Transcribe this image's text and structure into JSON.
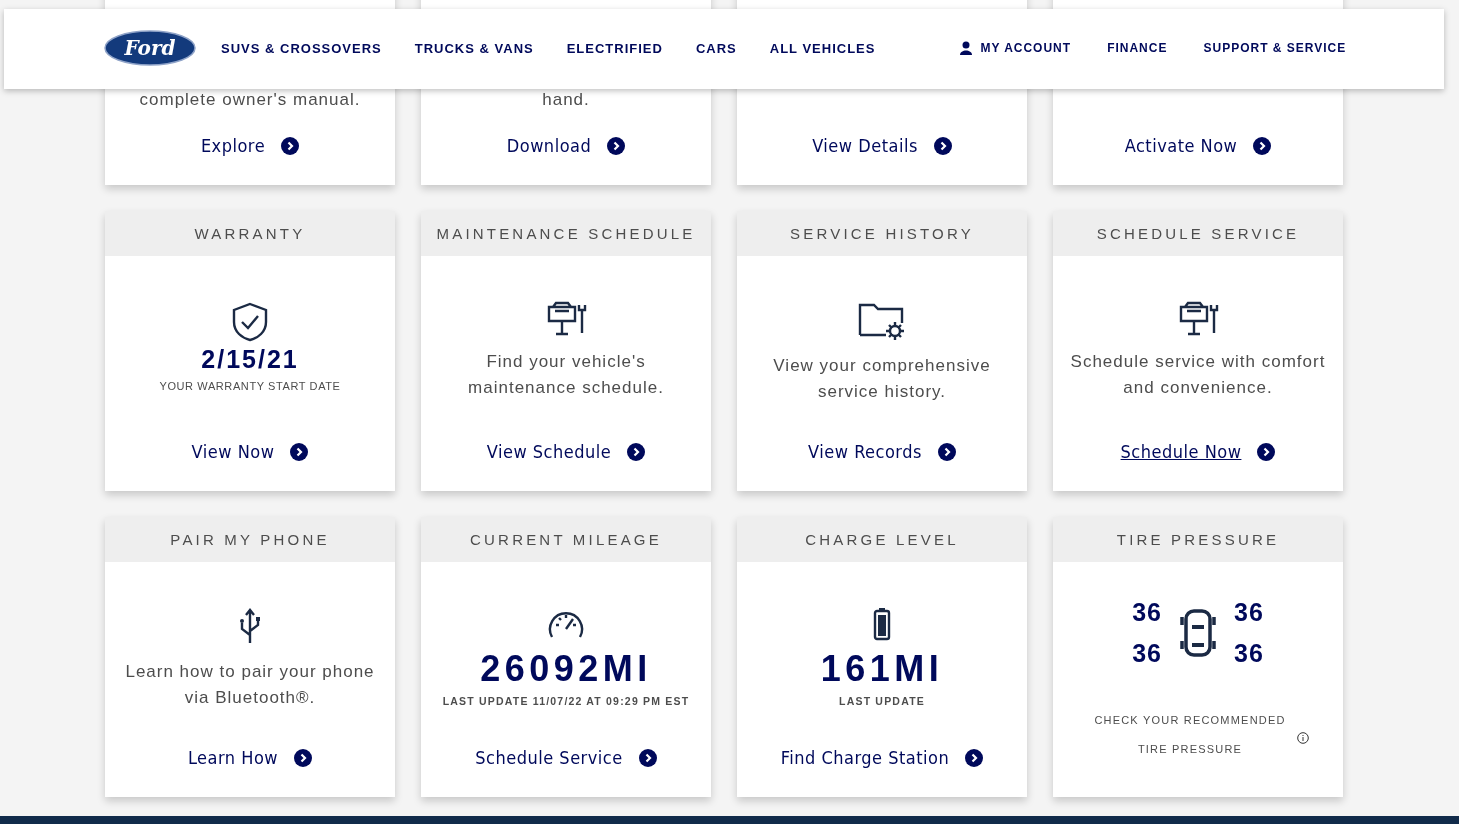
{
  "header": {
    "logo": "Ford",
    "nav": [
      {
        "label": "SUVS & CROSSOVERS"
      },
      {
        "label": "TRUCKS & VANS"
      },
      {
        "label": "ELECTRIFIED"
      },
      {
        "label": "CARS"
      },
      {
        "label": "ALL VEHICLES"
      }
    ],
    "account_nav": [
      {
        "label": "MY ACCOUNT",
        "kind": "account"
      },
      {
        "label": "FINANCE",
        "kind": "plain"
      },
      {
        "label": "SUPPORT & SERVICE",
        "kind": "plain"
      }
    ]
  },
  "cards": [
    {
      "kind": "partial",
      "text": "complete owner's manual.",
      "link": {
        "label": "Explore",
        "focused": false
      }
    },
    {
      "kind": "partial",
      "text": "hand.",
      "link": {
        "label": "Download",
        "focused": false
      }
    },
    {
      "kind": "partial",
      "link": {
        "label": "View Details",
        "focused": false
      }
    },
    {
      "kind": "partial",
      "link": {
        "label": "Activate Now",
        "focused": false
      }
    },
    {
      "kind": "value",
      "title": "WARRANTY",
      "value": "2/15/21",
      "caption": "YOUR WARRANTY START DATE",
      "link": {
        "label": "View Now",
        "focused": false
      }
    },
    {
      "kind": "text",
      "title": "MAINTENANCE SCHEDULE",
      "text": "Find your vehicle's maintenance schedule.",
      "link": {
        "label": "View Schedule",
        "focused": false
      }
    },
    {
      "kind": "text",
      "title": "SERVICE HISTORY",
      "text": "View your comprehensive service history.",
      "link": {
        "label": "View Records",
        "focused": false
      }
    },
    {
      "kind": "text",
      "title": "SCHEDULE SERVICE",
      "text": "Schedule service with comfort and convenience.",
      "link": {
        "label": "Schedule Now",
        "focused": true
      }
    },
    {
      "kind": "text",
      "title": "PAIR MY PHONE",
      "text": "Learn how to pair your phone via Bluetooth®.",
      "link": {
        "label": "Learn How",
        "focused": false
      }
    },
    {
      "kind": "bigvalue",
      "title": "CURRENT MILEAGE",
      "value": "26092MI",
      "caption": "LAST UPDATE 11/07/22 AT 09:29 PM EST",
      "link": {
        "label": "Schedule Service",
        "focused": false
      }
    },
    {
      "kind": "bigvalue",
      "title": "CHARGE LEVEL",
      "value": "161MI",
      "caption": "LAST UPDATE",
      "link": {
        "label": "Find Charge Station",
        "focused": false
      }
    },
    {
      "kind": "tire",
      "title": "TIRE PRESSURE",
      "tires": [
        "36",
        "36",
        "36",
        "36"
      ],
      "caption": "CHECK YOUR RECOMMENDED TIRE PRESSURE"
    }
  ]
}
